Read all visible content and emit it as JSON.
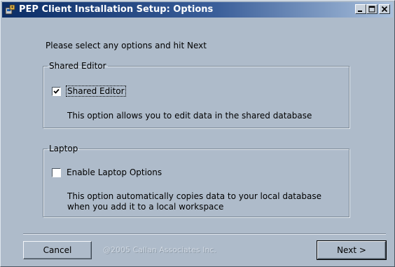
{
  "window": {
    "title": "PEP Client Installation Setup: Options",
    "icon": "installer-icon",
    "caption_buttons": [
      "minimize",
      "maximize",
      "close"
    ]
  },
  "prompt": "Please select any options and hit Next",
  "groups": [
    {
      "legend": "Shared Editor",
      "checkbox_label": "Shared Editor",
      "checked": true,
      "description": "This option allows you to edit data in the shared database"
    },
    {
      "legend": "Laptop",
      "checkbox_label": "Enable Laptop Options",
      "checked": false,
      "description": "This option automatically copies data to your local database when you add it to a local workspace"
    }
  ],
  "footer": {
    "cancel_label": "Cancel",
    "copyright": "@2005 Callan Associates Inc.",
    "next_label": "Next >"
  }
}
